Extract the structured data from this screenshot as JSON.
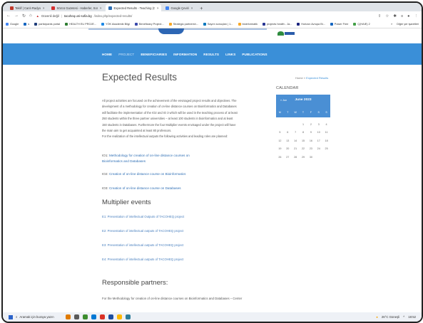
{
  "browser": {
    "tabs": [
      {
        "label": "Teklif | Canlı Radyo",
        "color": "#c0392b",
        "active": false
      },
      {
        "label": "Sözcü Gazetesi - Haberler, Son",
        "color": "#d32f2f",
        "active": false
      },
      {
        "label": "Expected Results - Teaching (O)",
        "color": "#2e6fb5",
        "active": true
      },
      {
        "label": "Google Çeviri",
        "color": "#4285f4",
        "active": false
      }
    ],
    "close_glyph": "×",
    "new_tab_glyph": "+",
    "security_label": "Güvenli değil",
    "url_host": "tacoheq.uni-sofia.bg",
    "url_path": "/index.php/expected-results/",
    "bookmarks": [
      {
        "label": "Google",
        "color": "#4285f4"
      },
      {
        "label": "s",
        "color": "#1565c0"
      },
      {
        "label": "participants portal",
        "color": "#1f3d7a"
      },
      {
        "label": "HEALTH EU PROJE...",
        "color": "#2e7d32"
      },
      {
        "label": "YÖK Akademik Bilgi",
        "color": "#1e88e5"
      },
      {
        "label": "Beneficiary Project...",
        "color": "#3949ab"
      },
      {
        "label": "Strategic partnersh...",
        "color": "#f9a825"
      },
      {
        "label": "Sayım sonuçları | 1...",
        "color": "#0277bd"
      },
      {
        "label": "bioinformatik",
        "color": "#f9a825"
      },
      {
        "label": "projects health - Ja...",
        "color": "#283593"
      },
      {
        "label": "Horizon Avrupa Bi...",
        "color": "#1a237e"
      },
      {
        "label": "Power Free",
        "color": "#1565c0"
      },
      {
        "label": "Ç(HAIE) 2",
        "color": "#43a047"
      }
    ],
    "other_bookmarks": "Diğer yer işaretleri"
  },
  "nav": {
    "items": [
      {
        "label": "HOME",
        "active": false
      },
      {
        "label": "PROJECT",
        "active": true
      },
      {
        "label": "BENEFICIARIES",
        "active": false
      },
      {
        "label": "INFORMATION",
        "active": false
      },
      {
        "label": "RESULTS",
        "active": false
      },
      {
        "label": "LINKS",
        "active": false
      },
      {
        "label": "PUBLICATIONS",
        "active": false
      }
    ]
  },
  "page": {
    "title": "Expected Results",
    "breadcrumb_home": "Home",
    "breadcrumb_sep": "»",
    "breadcrumb_current": "Expected Results",
    "intro": [
      "All project activities are focused on the achievement of the envisaged project results and objectives. The",
      "development of a methodology for creation of on-line distance courses on Bioinformatics and Databases",
      "will facilitate the implementation of the IO2 and IO 3 which will be used in the teaching process of at least",
      "250 students within the three partner universities – at least 100 students in bioinformatics and at least",
      "150 students in Databases. Furthermore the four Multiplier events envisaged under the project will have",
      "the main aim to get acquainted at least 80 professors.",
      "For the realization of the intellectual outputs the following activities and leading roles are planned:"
    ],
    "io1_prefix": "IO1:",
    "io1_link_a": "Methodology for creation of on-line distance courses on",
    "io1_link_b": "Bioinformatics and Databases",
    "io2_prefix": "IO2:",
    "io2_link": "Creation of on-line distance course on Bioinformatics",
    "io3_prefix": "IO3:",
    "io3_link": "Creation of on-line distance course on Databases",
    "multiplier_heading": "Multiplier events",
    "multiplier_links": [
      "E1: Presentation of intellectual Outputs of TACOHEQ project",
      "E2: Presentation of intellectual outputs of TACOHEQ project",
      "E3: Presentation of intellectual outputs of TACOHEQ project",
      "E4: Presentation of intellectual outputs of TACOHEQ project"
    ],
    "partners_heading": "Responsible partners:",
    "partners_text": "For the Methodology for creation of on-line distance courses on Bioinformatics and Databases – Center"
  },
  "calendar": {
    "heading": "CALENDAR",
    "prev": "« Jun",
    "month": "June 2023",
    "dows": [
      "M",
      "T",
      "W",
      "T",
      "F",
      "S",
      "S"
    ],
    "weeks": [
      [
        "",
        "",
        "",
        "1",
        "2",
        "3",
        "4"
      ],
      [
        "5",
        "6",
        "7",
        "8",
        "9",
        "10",
        "11"
      ],
      [
        "12",
        "13",
        "14",
        "15",
        "16",
        "17",
        "18"
      ],
      [
        "19",
        "20",
        "21",
        "22",
        "23",
        "24",
        "25"
      ],
      [
        "26",
        "27",
        "28",
        "29",
        "30",
        "",
        ""
      ]
    ]
  },
  "taskbar": {
    "search_placeholder": "Aramak için buraya yazın",
    "weather": "26°C Güneşli",
    "time": "18:52",
    "apps": [
      "#e07b00",
      "#5a5a5a",
      "#3c8d2f",
      "#0078d4",
      "#d93025",
      "#1e4fa0",
      "#ffb900",
      "#2d7d9a"
    ]
  }
}
